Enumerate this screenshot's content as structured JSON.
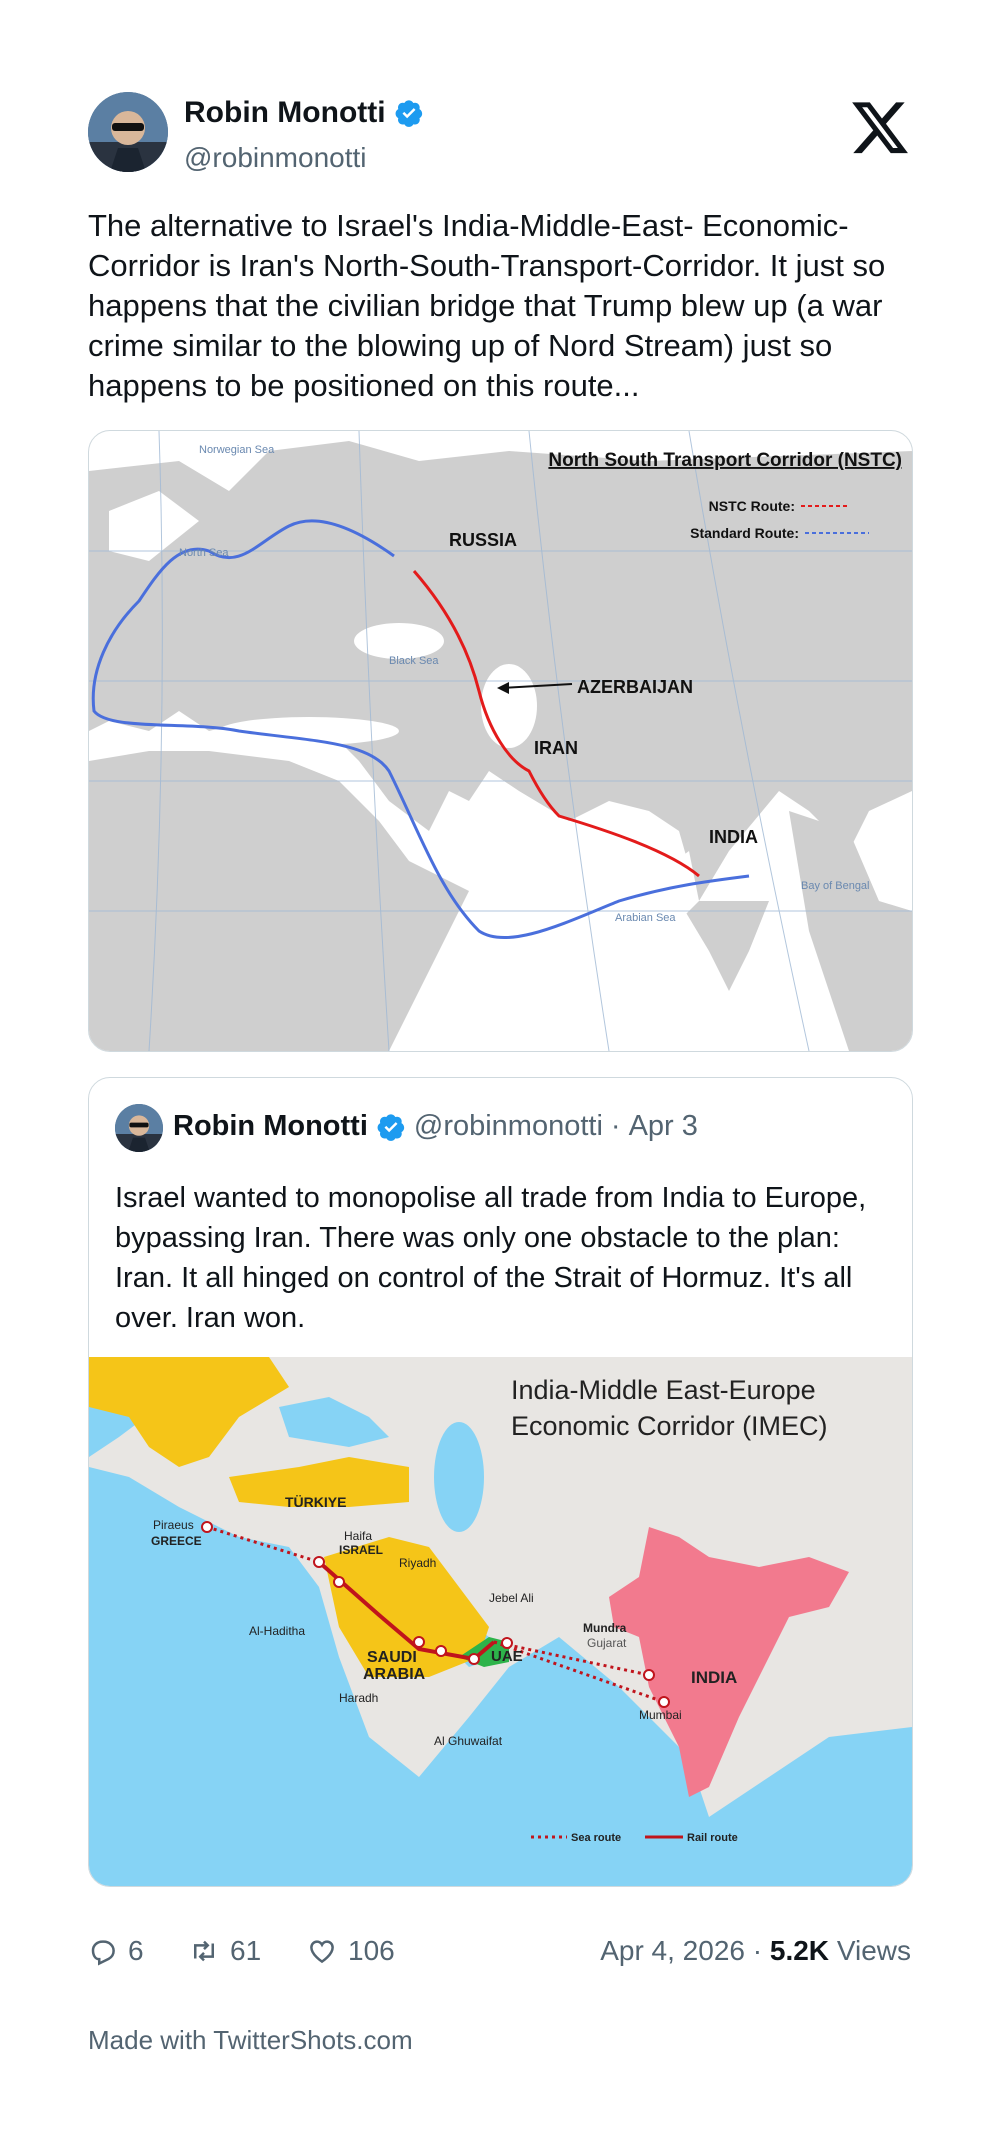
{
  "author": {
    "name": "Robin Monotti",
    "handle": "@robinmonotti"
  },
  "tweet_text": "The alternative to Israel's India-Middle-East- Economic-Corridor is Iran's North-South-Transport-Corridor. It just so happens that the civilian bridge that Trump blew up (a war crime similar to the blowing up of Nord Stream) just so happens to be positioned on this route...",
  "map1": {
    "title": "North South Transport Corridor (NSTC)",
    "legend_nstc": "NSTC Route:",
    "legend_standard": "Standard Route:",
    "labels": {
      "russia": "RUSSIA",
      "azerbaijan": "AZERBAIJAN",
      "iran": "IRAN",
      "india": "INDIA",
      "norwegian_sea": "Norwegian Sea",
      "north_sea": "North Sea",
      "black_sea": "Black Sea",
      "arabian_sea": "Arabian Sea",
      "bay_of_bengal": "Bay of Bengal"
    },
    "colors": {
      "nstc": "#e31b1b",
      "standard": "#4a6fdc"
    }
  },
  "quote": {
    "name": "Robin Monotti",
    "handle": "@robinmonotti",
    "date": "Apr 3",
    "separator": "·",
    "text": "Israel wanted to monopolise all trade from India to Europe, bypassing Iran. There was only one obstacle to the plan: Iran. It all hinged on control of the Strait of Hormuz. It's all over. Iran won.",
    "map": {
      "title_line1": "India-Middle East-Europe",
      "title_line2": "Economic Corridor (IMEC)",
      "labels": {
        "turkiye": "TÜRKIYE",
        "piraeus": "Piraeus",
        "greece": "GREECE",
        "haifa": "Haifa",
        "israel": "ISRAEL",
        "riyadh": "Riyadh",
        "jebel_ali": "Jebel Ali",
        "al_haditha": "Al-Haditha",
        "saudi1": "SAUDI",
        "saudi2": "ARABIA",
        "uae": "UAE",
        "haradh": "Haradh",
        "al_ghuwaifat": "Al Ghuwaifat",
        "mundra": "Mundra",
        "gujarat": "Gujarat",
        "mumbai": "Mumbai",
        "india": "INDIA"
      },
      "legend_sea": "Sea route",
      "legend_rail": "Rail route",
      "colors": {
        "india": "#f27a8e",
        "saudi": "#f5c518",
        "uae": "#2db34a",
        "water": "#86d3f5",
        "route": "#c0141c"
      }
    }
  },
  "actions": {
    "replies": "6",
    "retweets": "61",
    "likes": "106",
    "date": "Apr 4, 2026",
    "views_count": "5.2K",
    "views_label": "Views",
    "separator": "·"
  },
  "footer": "Made with TwitterShots.com",
  "colors": {
    "verified": "#1d9bf0",
    "text": "#0f1419",
    "muted": "#536471"
  }
}
